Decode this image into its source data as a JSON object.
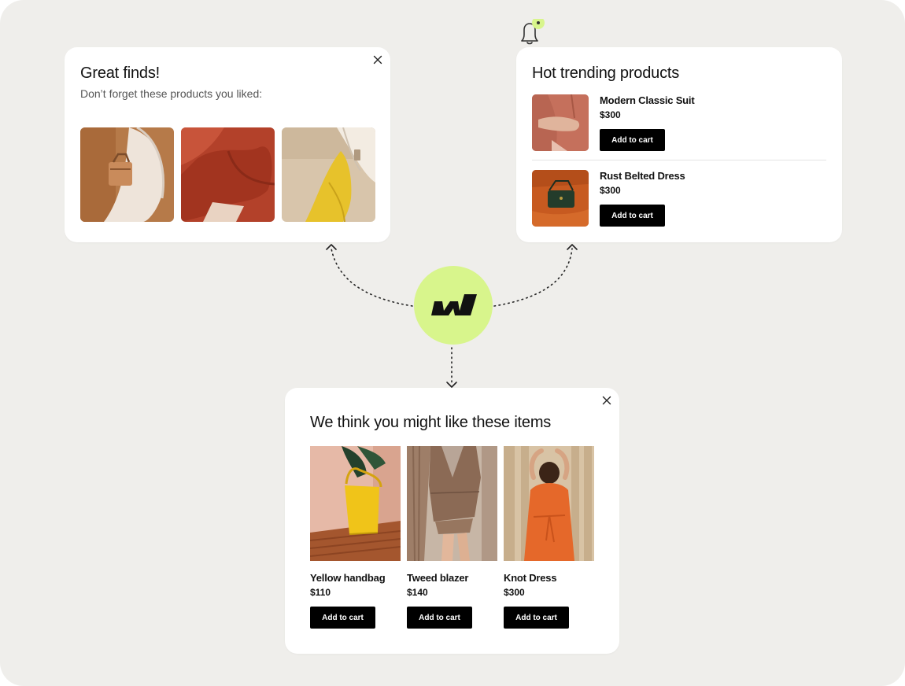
{
  "colors": {
    "background": "#efeeeb",
    "card": "#ffffff",
    "accent_lime": "#d8f58c",
    "button": "#000000"
  },
  "icons": {
    "close": "close-icon",
    "bell": "bell-icon",
    "logo": "brand-logo"
  },
  "great_finds": {
    "title": "Great finds!",
    "subtitle": "Don’t forget these products you liked:",
    "images": [
      "tan-handbag-image",
      "rust-skirt-image",
      "yellow-outfit-image"
    ]
  },
  "trending": {
    "title": "Hot trending products",
    "items": [
      {
        "name": "Modern Classic Suit",
        "price": "$300",
        "button": "Add to cart"
      },
      {
        "name": "Rust Belted Dress",
        "price": "$300",
        "button": "Add to cart"
      }
    ]
  },
  "recommendations": {
    "title": "We think you might like these items",
    "items": [
      {
        "name": "Yellow handbag",
        "price": "$110",
        "button": "Add to cart"
      },
      {
        "name": "Tweed blazer",
        "price": "$140",
        "button": "Add to cart"
      },
      {
        "name": "Knot Dress",
        "price": "$300",
        "button": "Add to cart"
      }
    ]
  }
}
